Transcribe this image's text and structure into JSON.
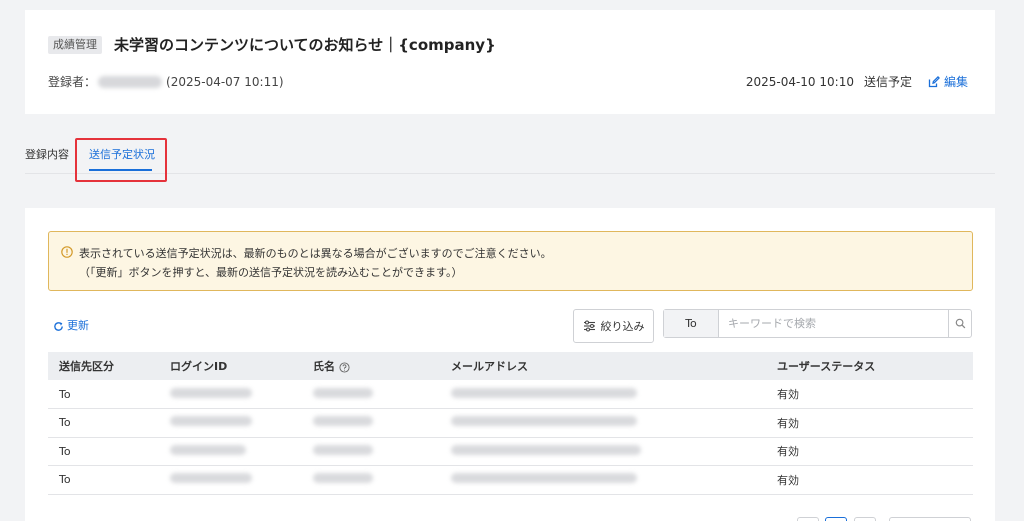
{
  "header": {
    "category": "成績管理",
    "title": "未学習のコンテンツについてのお知らせ｜{company}",
    "registrant_label": "登録者：",
    "registered_at": "(2025-04-07 10:11)",
    "send_datetime": "2025-04-10 10:10",
    "send_status": "送信予定",
    "edit_label": "編集"
  },
  "tabs": [
    {
      "label": "登録内容"
    },
    {
      "label": "送信予定状況"
    }
  ],
  "notice": {
    "line1": "表示されている送信予定状況は、最新のものとは異なる場合がございますのでご注意ください。",
    "line2": "（「更新」ボタンを押すと、最新の送信予定状況を読み込むことができます。）"
  },
  "toolbar": {
    "refresh_label": "更新",
    "filter_label": "絞り込み",
    "search_scope": "To",
    "search_placeholder": "キーワードで検索"
  },
  "table": {
    "headers": [
      "送信先区分",
      "ログインID",
      "氏名",
      "メールアドレス",
      "ユーザーステータス"
    ],
    "rows": [
      {
        "type": "To",
        "status": "有効"
      },
      {
        "type": "To",
        "status": "有効"
      },
      {
        "type": "To",
        "status": "有効"
      },
      {
        "type": "To",
        "status": "有効"
      }
    ]
  },
  "colors": {
    "accent": "#1a6fd9",
    "highlight_border": "#e5323a",
    "notice_bg": "#fdf6e3",
    "notice_border": "#e0b75c"
  }
}
